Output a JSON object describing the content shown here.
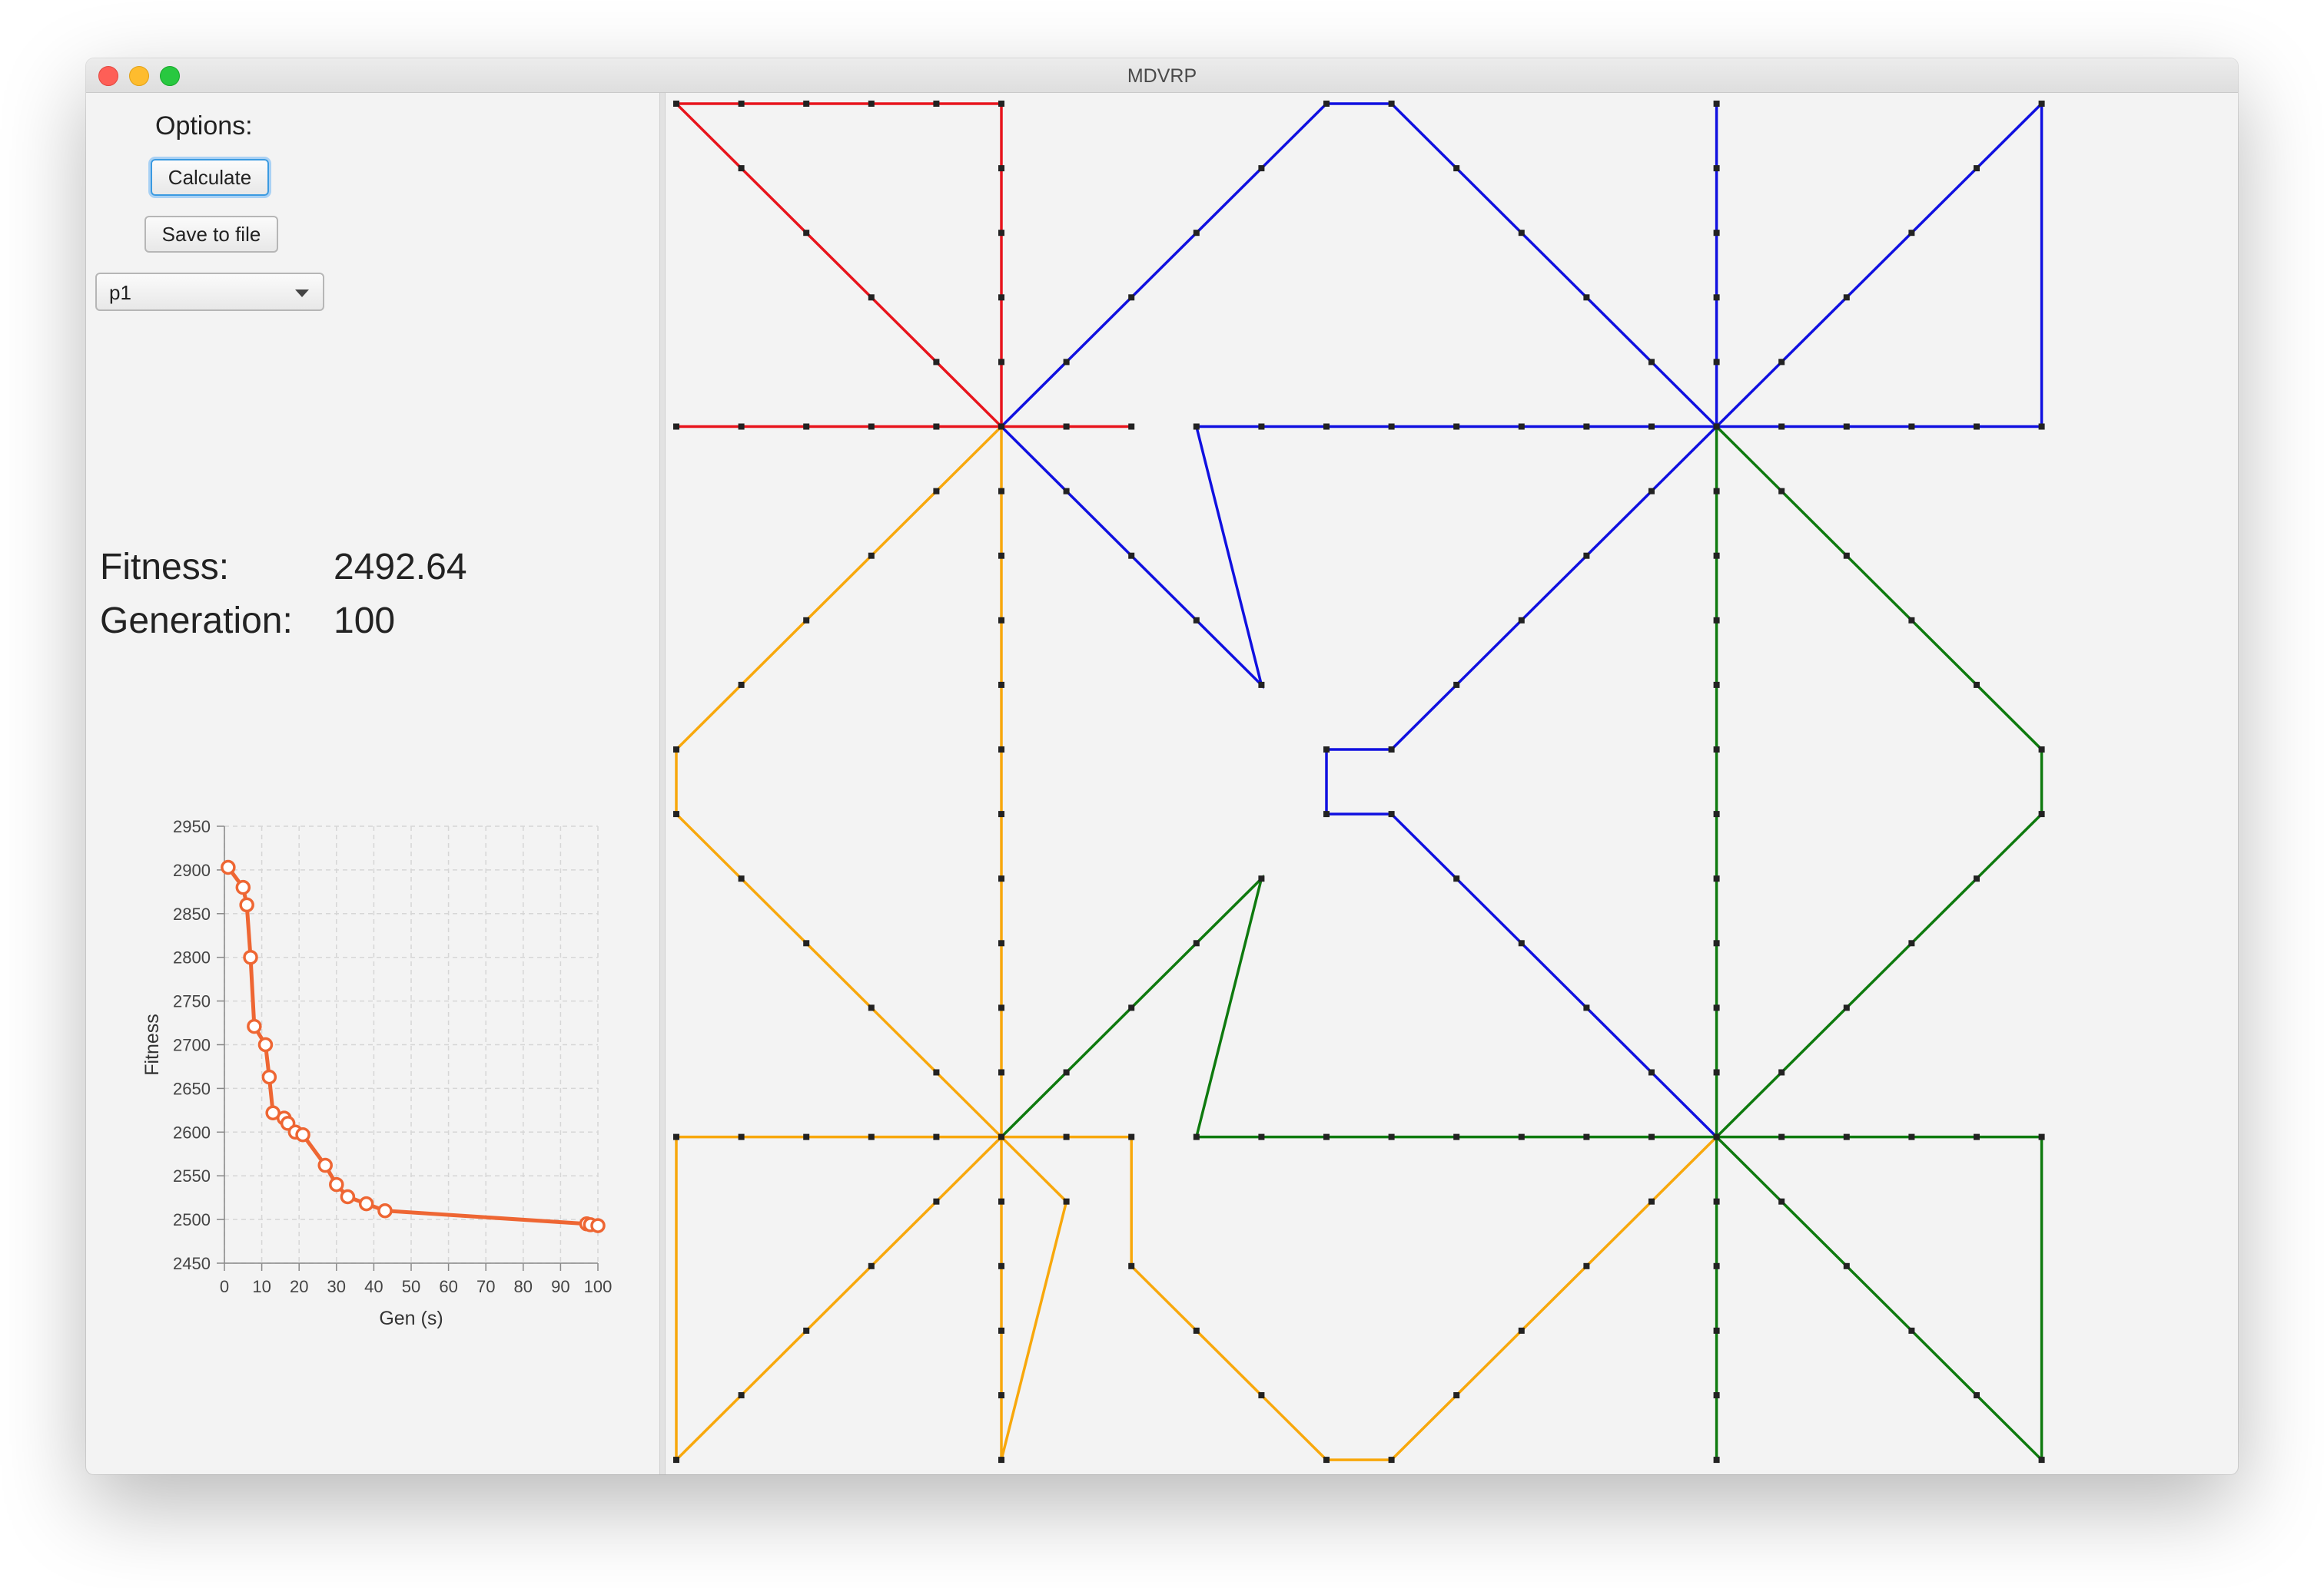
{
  "window": {
    "title": "MDVRP"
  },
  "options": {
    "label": "Options:",
    "calculate_label": "Calculate",
    "save_label": "Save to file",
    "problem_value": "p1"
  },
  "stats": {
    "fitness_label": "Fitness:",
    "fitness_value": "2492.64",
    "generation_label": "Generation:",
    "generation_value": "100"
  },
  "chart_data": {
    "type": "line",
    "xlabel": "Gen (s)",
    "ylabel": "Fitness",
    "xlim": [
      0,
      100
    ],
    "ylim": [
      2450,
      2950
    ],
    "xticks": [
      0,
      10,
      20,
      30,
      40,
      50,
      60,
      70,
      80,
      90,
      100
    ],
    "yticks": [
      2450,
      2500,
      2550,
      2600,
      2650,
      2700,
      2750,
      2800,
      2850,
      2900,
      2950
    ],
    "grid": true,
    "color": "#ee6633",
    "x": [
      1,
      5,
      6,
      7,
      8,
      11,
      12,
      13,
      16,
      17,
      19,
      21,
      27,
      30,
      33,
      38,
      43,
      97,
      98,
      100
    ],
    "y": [
      2903,
      2880,
      2860,
      2800,
      2721,
      2700,
      2663,
      2622,
      2616,
      2610,
      2600,
      2597,
      2562,
      2540,
      2526,
      2518,
      2510,
      2495,
      2494,
      2493
    ]
  },
  "map_data": {
    "colors": {
      "red": "#e8141c",
      "blue": "#1010e0",
      "orange": "#f8a80c",
      "green": "#0e7a0e",
      "marker": "#222222"
    },
    "grid_max": [
      20,
      20
    ],
    "depots": [
      [
        5,
        0
      ],
      [
        16,
        0
      ],
      [
        5,
        5
      ],
      [
        16,
        5
      ],
      [
        5,
        16
      ],
      [
        16,
        16
      ],
      [
        5,
        21
      ],
      [
        16,
        21
      ]
    ],
    "routes": [
      {
        "color": "red",
        "points": [
          [
            0,
            0
          ],
          [
            1,
            1
          ],
          [
            2,
            2
          ],
          [
            3,
            3
          ],
          [
            4,
            4
          ],
          [
            5,
            5
          ],
          [
            4,
            5
          ],
          [
            3,
            5
          ],
          [
            2,
            5
          ],
          [
            1,
            5
          ],
          [
            0,
            5
          ]
        ]
      },
      {
        "color": "red",
        "points": [
          [
            5,
            5
          ],
          [
            5,
            4
          ],
          [
            5,
            3
          ],
          [
            5,
            2
          ],
          [
            5,
            1
          ],
          [
            5,
            0
          ],
          [
            4,
            0
          ],
          [
            3,
            0
          ],
          [
            2,
            0
          ],
          [
            1,
            0
          ],
          [
            0,
            0
          ]
        ]
      },
      {
        "color": "red",
        "points": [
          [
            5,
            5
          ],
          [
            6,
            5
          ],
          [
            7,
            5
          ]
        ]
      },
      {
        "color": "blue",
        "points": [
          [
            5,
            5
          ],
          [
            6,
            4
          ],
          [
            7,
            3
          ],
          [
            8,
            2
          ],
          [
            9,
            1
          ],
          [
            10,
            0
          ],
          [
            11,
            0
          ],
          [
            12,
            1
          ],
          [
            13,
            2
          ],
          [
            14,
            3
          ],
          [
            15,
            4
          ],
          [
            16,
            5
          ]
        ]
      },
      {
        "color": "blue",
        "points": [
          [
            5,
            5
          ],
          [
            6,
            6
          ],
          [
            7,
            7
          ],
          [
            8,
            8
          ],
          [
            9,
            9
          ],
          [
            8,
            5
          ],
          [
            9,
            5
          ],
          [
            10,
            5
          ],
          [
            11,
            5
          ],
          [
            12,
            5
          ],
          [
            13,
            5
          ],
          [
            14,
            5
          ],
          [
            15,
            5
          ],
          [
            16,
            5
          ]
        ]
      },
      {
        "color": "blue",
        "points": [
          [
            16,
            5
          ],
          [
            16,
            4
          ],
          [
            16,
            3
          ],
          [
            16,
            2
          ],
          [
            16,
            1
          ],
          [
            16,
            0
          ]
        ]
      },
      {
        "color": "blue",
        "points": [
          [
            16,
            5
          ],
          [
            17,
            4
          ],
          [
            18,
            3
          ],
          [
            19,
            2
          ],
          [
            20,
            1
          ],
          [
            21,
            0
          ],
          [
            21,
            5
          ],
          [
            20,
            5
          ],
          [
            19,
            5
          ],
          [
            18,
            5
          ],
          [
            17,
            5
          ],
          [
            16,
            5
          ]
        ]
      },
      {
        "color": "blue",
        "points": [
          [
            16,
            5
          ],
          [
            15,
            6
          ],
          [
            14,
            7
          ],
          [
            13,
            8
          ],
          [
            12,
            9
          ],
          [
            11,
            10
          ],
          [
            10,
            10
          ],
          [
            10,
            11
          ],
          [
            11,
            11
          ],
          [
            12,
            12
          ],
          [
            13,
            13
          ],
          [
            14,
            14
          ],
          [
            15,
            15
          ],
          [
            16,
            16
          ]
        ]
      },
      {
        "color": "orange",
        "points": [
          [
            5,
            5
          ],
          [
            4,
            6
          ],
          [
            3,
            7
          ],
          [
            2,
            8
          ],
          [
            1,
            9
          ],
          [
            0,
            10
          ],
          [
            0,
            11
          ],
          [
            1,
            12
          ],
          [
            2,
            13
          ],
          [
            3,
            14
          ],
          [
            4,
            15
          ],
          [
            5,
            16
          ]
        ]
      },
      {
        "color": "orange",
        "points": [
          [
            5,
            5
          ],
          [
            5,
            6
          ],
          [
            5,
            7
          ],
          [
            5,
            8
          ],
          [
            5,
            9
          ],
          [
            5,
            10
          ],
          [
            5,
            11
          ],
          [
            5,
            12
          ],
          [
            5,
            13
          ],
          [
            5,
            14
          ],
          [
            5,
            15
          ],
          [
            5,
            16
          ]
        ]
      },
      {
        "color": "orange",
        "points": [
          [
            5,
            16
          ],
          [
            4,
            16
          ],
          [
            3,
            16
          ],
          [
            2,
            16
          ],
          [
            1,
            16
          ],
          [
            0,
            16
          ],
          [
            0,
            21
          ],
          [
            1,
            20
          ],
          [
            2,
            19
          ],
          [
            3,
            18
          ],
          [
            4,
            17
          ],
          [
            5,
            16
          ]
        ]
      },
      {
        "color": "orange",
        "points": [
          [
            5,
            16
          ],
          [
            5,
            17
          ],
          [
            5,
            18
          ],
          [
            5,
            19
          ],
          [
            5,
            20
          ],
          [
            5,
            21
          ],
          [
            6,
            17
          ],
          [
            5,
            16
          ]
        ]
      },
      {
        "color": "orange",
        "points": [
          [
            5,
            16
          ],
          [
            6,
            16
          ],
          [
            7,
            16
          ],
          [
            7,
            18
          ],
          [
            8,
            19
          ],
          [
            9,
            20
          ],
          [
            10,
            21
          ],
          [
            11,
            21
          ],
          [
            12,
            20
          ],
          [
            13,
            19
          ],
          [
            14,
            18
          ],
          [
            15,
            17
          ],
          [
            16,
            16
          ]
        ]
      },
      {
        "color": "green",
        "points": [
          [
            5,
            16
          ],
          [
            6,
            15
          ],
          [
            7,
            14
          ],
          [
            8,
            13
          ],
          [
            9,
            12
          ],
          [
            8,
            16
          ],
          [
            9,
            16
          ],
          [
            10,
            16
          ],
          [
            11,
            16
          ],
          [
            12,
            16
          ],
          [
            13,
            16
          ],
          [
            14,
            16
          ],
          [
            15,
            16
          ],
          [
            16,
            16
          ]
        ]
      },
      {
        "color": "green",
        "points": [
          [
            16,
            5
          ],
          [
            16,
            6
          ],
          [
            16,
            7
          ],
          [
            16,
            8
          ],
          [
            16,
            9
          ],
          [
            16,
            10
          ],
          [
            16,
            11
          ],
          [
            16,
            12
          ],
          [
            16,
            13
          ],
          [
            16,
            14
          ],
          [
            16,
            15
          ],
          [
            16,
            16
          ]
        ]
      },
      {
        "color": "green",
        "points": [
          [
            16,
            5
          ],
          [
            17,
            6
          ],
          [
            18,
            7
          ],
          [
            19,
            8
          ],
          [
            20,
            9
          ],
          [
            21,
            10
          ],
          [
            21,
            11
          ],
          [
            20,
            12
          ],
          [
            19,
            13
          ],
          [
            18,
            14
          ],
          [
            17,
            15
          ],
          [
            16,
            16
          ]
        ]
      },
      {
        "color": "green",
        "points": [
          [
            16,
            16
          ],
          [
            17,
            16
          ],
          [
            18,
            16
          ],
          [
            19,
            16
          ],
          [
            20,
            16
          ],
          [
            21,
            16
          ],
          [
            21,
            21
          ],
          [
            20,
            20
          ],
          [
            19,
            19
          ],
          [
            18,
            18
          ],
          [
            17,
            17
          ],
          [
            16,
            16
          ]
        ]
      },
      {
        "color": "green",
        "points": [
          [
            16,
            16
          ],
          [
            16,
            17
          ],
          [
            16,
            18
          ],
          [
            16,
            19
          ],
          [
            16,
            20
          ],
          [
            16,
            21
          ]
        ]
      }
    ]
  }
}
